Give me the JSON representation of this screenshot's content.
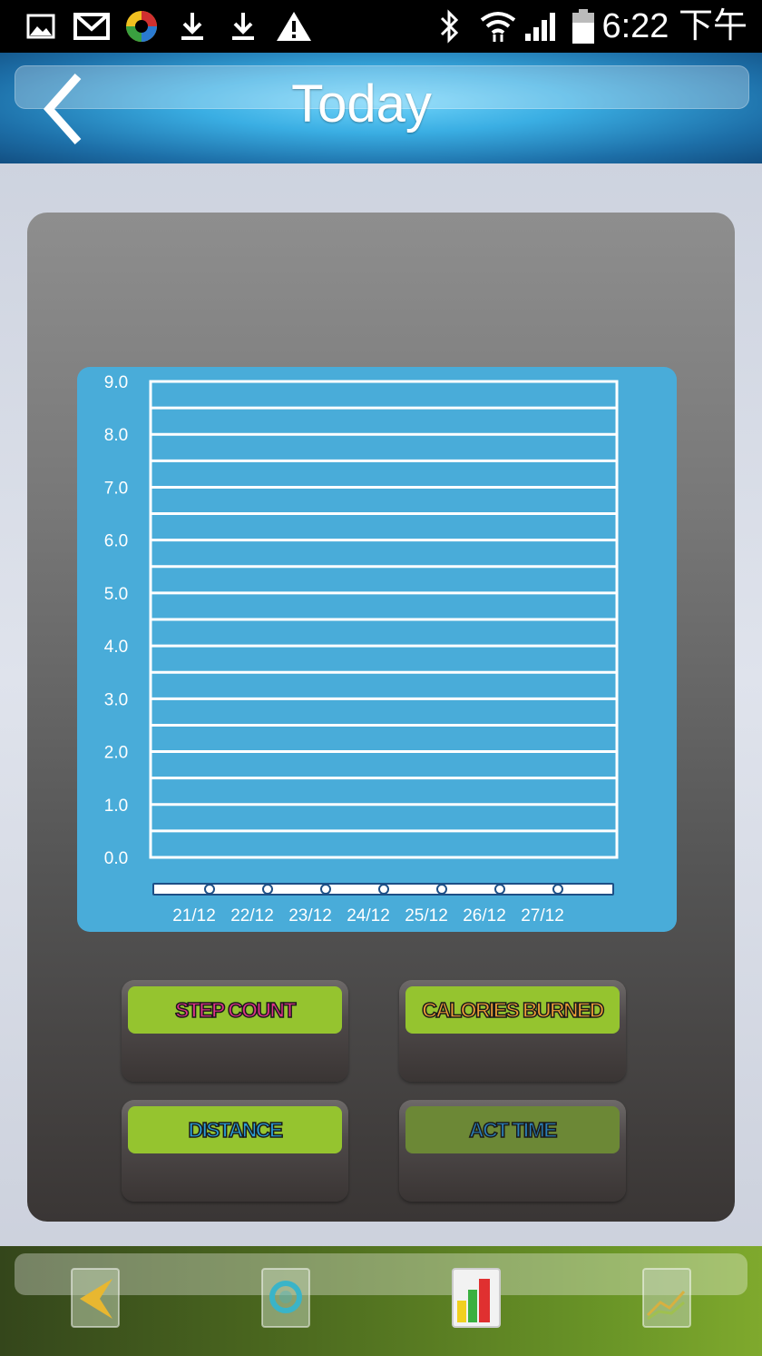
{
  "status_bar": {
    "time": "6:22 下午",
    "icons": [
      "gallery-icon",
      "gmail-icon",
      "colorwheel-app-icon",
      "download-icon",
      "download-icon",
      "warning-icon",
      "bluetooth-icon",
      "wifi-icon",
      "signal-icon",
      "battery-icon"
    ]
  },
  "header": {
    "title": "Today",
    "back_icon": "chevron-left-icon"
  },
  "chart_data": {
    "type": "line",
    "x": [
      "21/12",
      "22/12",
      "23/12",
      "24/12",
      "25/12",
      "26/12",
      "27/12"
    ],
    "y_ticks": [
      "0.0",
      "1.0",
      "2.0",
      "3.0",
      "4.0",
      "5.0",
      "6.0",
      "7.0",
      "8.0",
      "9.0"
    ],
    "ylim": [
      0,
      9
    ],
    "grid": true,
    "series": [
      {
        "values": [
          0,
          0,
          0,
          0,
          0,
          0,
          0
        ]
      }
    ]
  },
  "metrics": [
    {
      "label": "STEP COUNT",
      "color": "#e0338a",
      "active": true
    },
    {
      "label": "CALORIES BURNED",
      "color": "#f0a038",
      "active": true
    },
    {
      "label": "DISTANCE",
      "color": "#2ba0d8",
      "active": true
    },
    {
      "label": "ACT TIME",
      "color": "#2ba0d8",
      "active": false
    }
  ],
  "bottom_nav": [
    "share-icon",
    "search-icon",
    "bar-chart-icon",
    "line-chart-icon"
  ],
  "colors": {
    "header_accent": "#3aaee3",
    "chart_bg": "#49acd9",
    "button_green": "#95c42f"
  }
}
